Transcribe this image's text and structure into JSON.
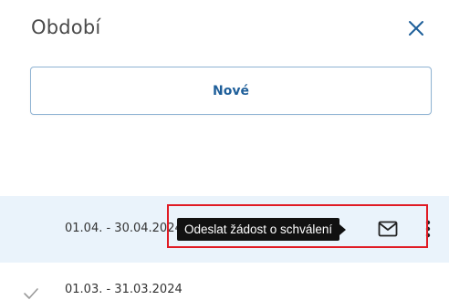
{
  "header": {
    "title": "Období",
    "close_icon": "close-icon"
  },
  "new_button": {
    "label": "Nové"
  },
  "periods": [
    {
      "range": "01.04. - 30.04.2024",
      "selected": true,
      "actions": {
        "send_icon": "mail-icon",
        "more_icon": "more-vertical-icon"
      },
      "tooltip": "Odeslat žádost o schválení"
    },
    {
      "range": "01.03. - 31.03.2024",
      "selected": false,
      "status_icon": "check-icon"
    }
  ],
  "colors": {
    "accent": "#1f5f9a",
    "selected_row_bg": "#eaf3fb",
    "highlight": "#e01b24",
    "tooltip_bg": "#111111"
  }
}
